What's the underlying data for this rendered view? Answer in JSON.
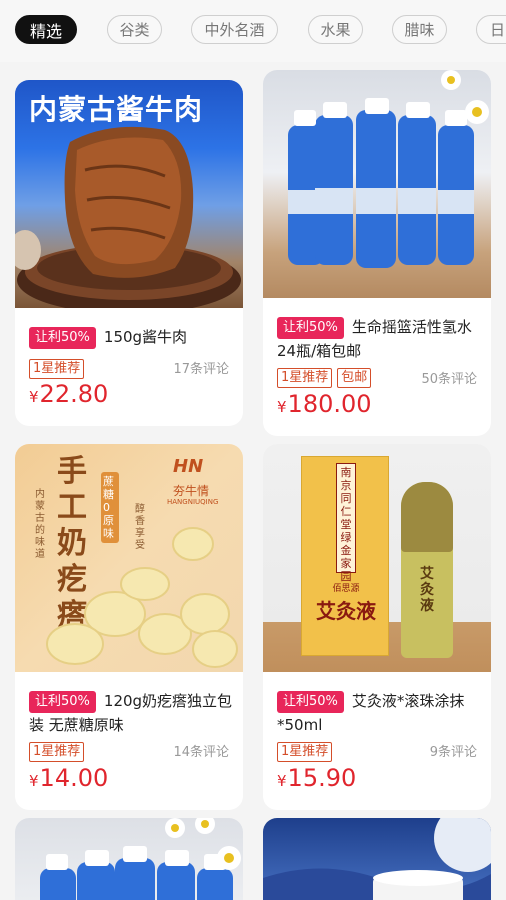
{
  "tabs": [
    {
      "label": "精选",
      "active": true
    },
    {
      "label": "谷类",
      "active": false
    },
    {
      "label": "中外名酒",
      "active": false
    },
    {
      "label": "水果",
      "active": false
    },
    {
      "label": "腊味",
      "active": false
    },
    {
      "label": "日",
      "active": false
    }
  ],
  "products": [
    {
      "image_text": "内蒙古酱牛肉",
      "profit": "让利50%",
      "title": "150g酱牛肉",
      "tags": [
        "1星推荐"
      ],
      "reviews": "17条评论",
      "currency": "¥",
      "price": "22.80"
    },
    {
      "image_text": "生命摇篮",
      "profit": "让利50%",
      "title": "生命摇篮活性氢水24瓶/箱包邮",
      "tags": [
        "1星推荐",
        "包邮"
      ],
      "reviews": "50条评论",
      "currency": "¥",
      "price": "180.00"
    },
    {
      "image_text": "手工奶疙瘩",
      "image_subtext": "蔗糖0原味",
      "image_side": "内蒙古的味道",
      "image_side2": "醇香享受",
      "brand_logo": "HN",
      "brand_name": "夯牛情",
      "brand_en": "HANGNIUQING",
      "profit": "让利50%",
      "title": "120g奶疙瘩独立包装 无蔗糖原味",
      "tags": [
        "1星推荐"
      ],
      "reviews": "14条评论",
      "currency": "¥",
      "price": "14.00"
    },
    {
      "image_text": "艾灸液",
      "box_vertical": "南京同仁堂绿金家园",
      "box_sub": "佰思源",
      "profit": "让利50%",
      "title": "艾灸液*滚珠涂抹*50ml",
      "tags": [
        "1星推荐"
      ],
      "reviews": "9条评论",
      "currency": "¥",
      "price": "15.90"
    }
  ],
  "colors": {
    "accent_red": "#e0252d",
    "profit_pink": "#e8265a",
    "tag_orange": "#d44e2a"
  }
}
